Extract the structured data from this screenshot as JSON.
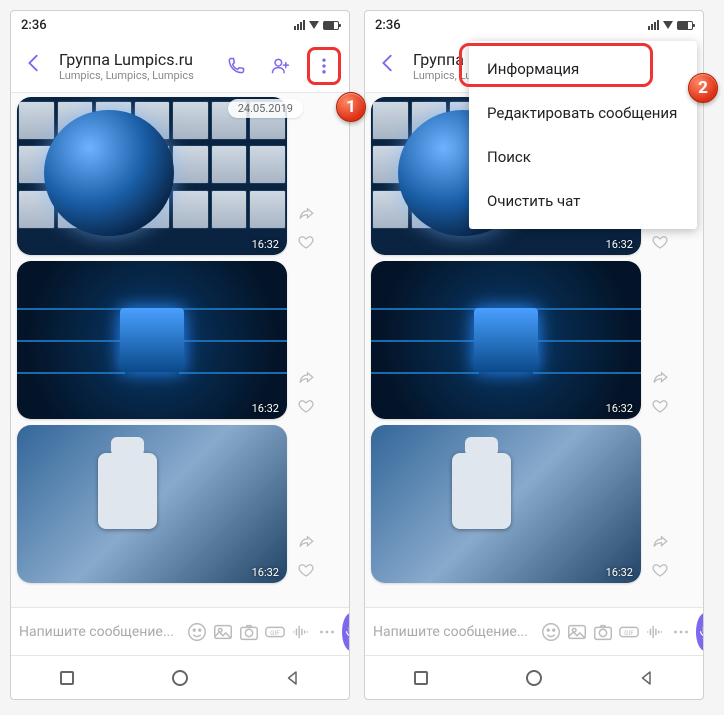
{
  "status": {
    "time": "2:36"
  },
  "header": {
    "title": "Группа Lumpics.ru",
    "subtitle": "Lumpics, Lumpics, Lumpics"
  },
  "chat": {
    "date": "24.05.2019",
    "messages": [
      {
        "time": "16:32"
      },
      {
        "time": "16:32"
      },
      {
        "time": "16:32"
      }
    ]
  },
  "input": {
    "placeholder": "Напишите сообщение..."
  },
  "menu": {
    "info": "Информация",
    "edit": "Редактировать сообщения",
    "search": "Поиск",
    "clear": "Очистить чат"
  },
  "badges": {
    "one": "1",
    "two": "2"
  }
}
